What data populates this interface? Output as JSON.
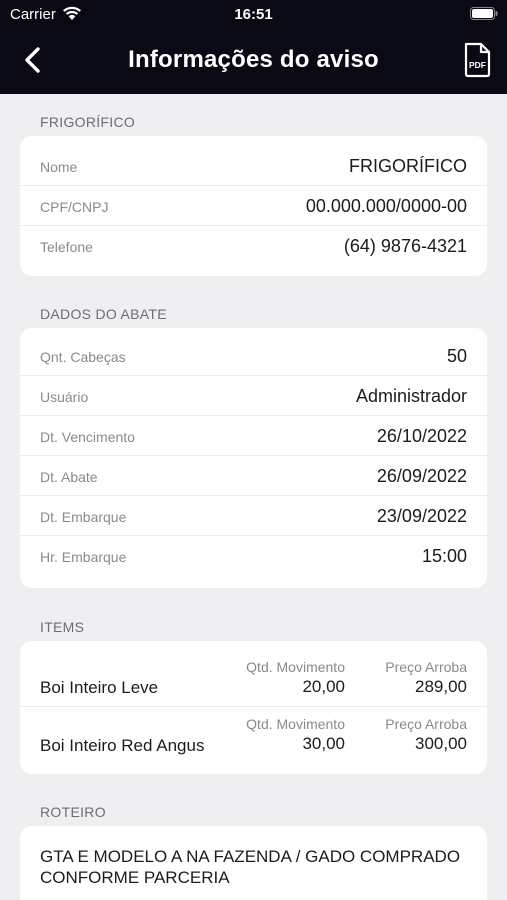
{
  "status_bar": {
    "carrier": "Carrier",
    "time": "16:51"
  },
  "nav": {
    "title": "Informações do aviso",
    "pdf_label": "PDF"
  },
  "frigorifico": {
    "header": "FRIGORÍFICO",
    "rows": [
      {
        "label": "Nome",
        "value": "FRIGORÍFICO"
      },
      {
        "label": "CPF/CNPJ",
        "value": "00.000.000/0000-00"
      },
      {
        "label": "Telefone",
        "value": "(64) 9876-4321"
      }
    ]
  },
  "dados_abate": {
    "header": "DADOS DO ABATE",
    "rows": [
      {
        "label": "Qnt. Cabeças",
        "value": "50"
      },
      {
        "label": "Usuário",
        "value": "Administrador"
      },
      {
        "label": "Dt. Vencimento",
        "value": "26/10/2022"
      },
      {
        "label": "Dt. Abate",
        "value": "26/09/2022"
      },
      {
        "label": "Dt. Embarque",
        "value": "23/09/2022"
      },
      {
        "label": "Hr. Embarque",
        "value": "15:00"
      }
    ]
  },
  "items": {
    "header": "ITEMS",
    "rows": [
      {
        "name": "Boi Inteiro Leve",
        "qtd_label": "Qtd. Movimento",
        "qtd_value": "20,00",
        "preco_label": "Preço Arroba",
        "preco_value": "289,00"
      },
      {
        "name": "Boi Inteiro Red Angus",
        "qtd_label": "Qtd. Movimento",
        "qtd_value": "30,00",
        "preco_label": "Preço Arroba",
        "preco_value": "300,00"
      }
    ]
  },
  "roteiro": {
    "header": "ROTEIRO",
    "text": "GTA E MODELO A NA FAZENDA / GADO COMPRADO CONFORME PARCERIA"
  }
}
